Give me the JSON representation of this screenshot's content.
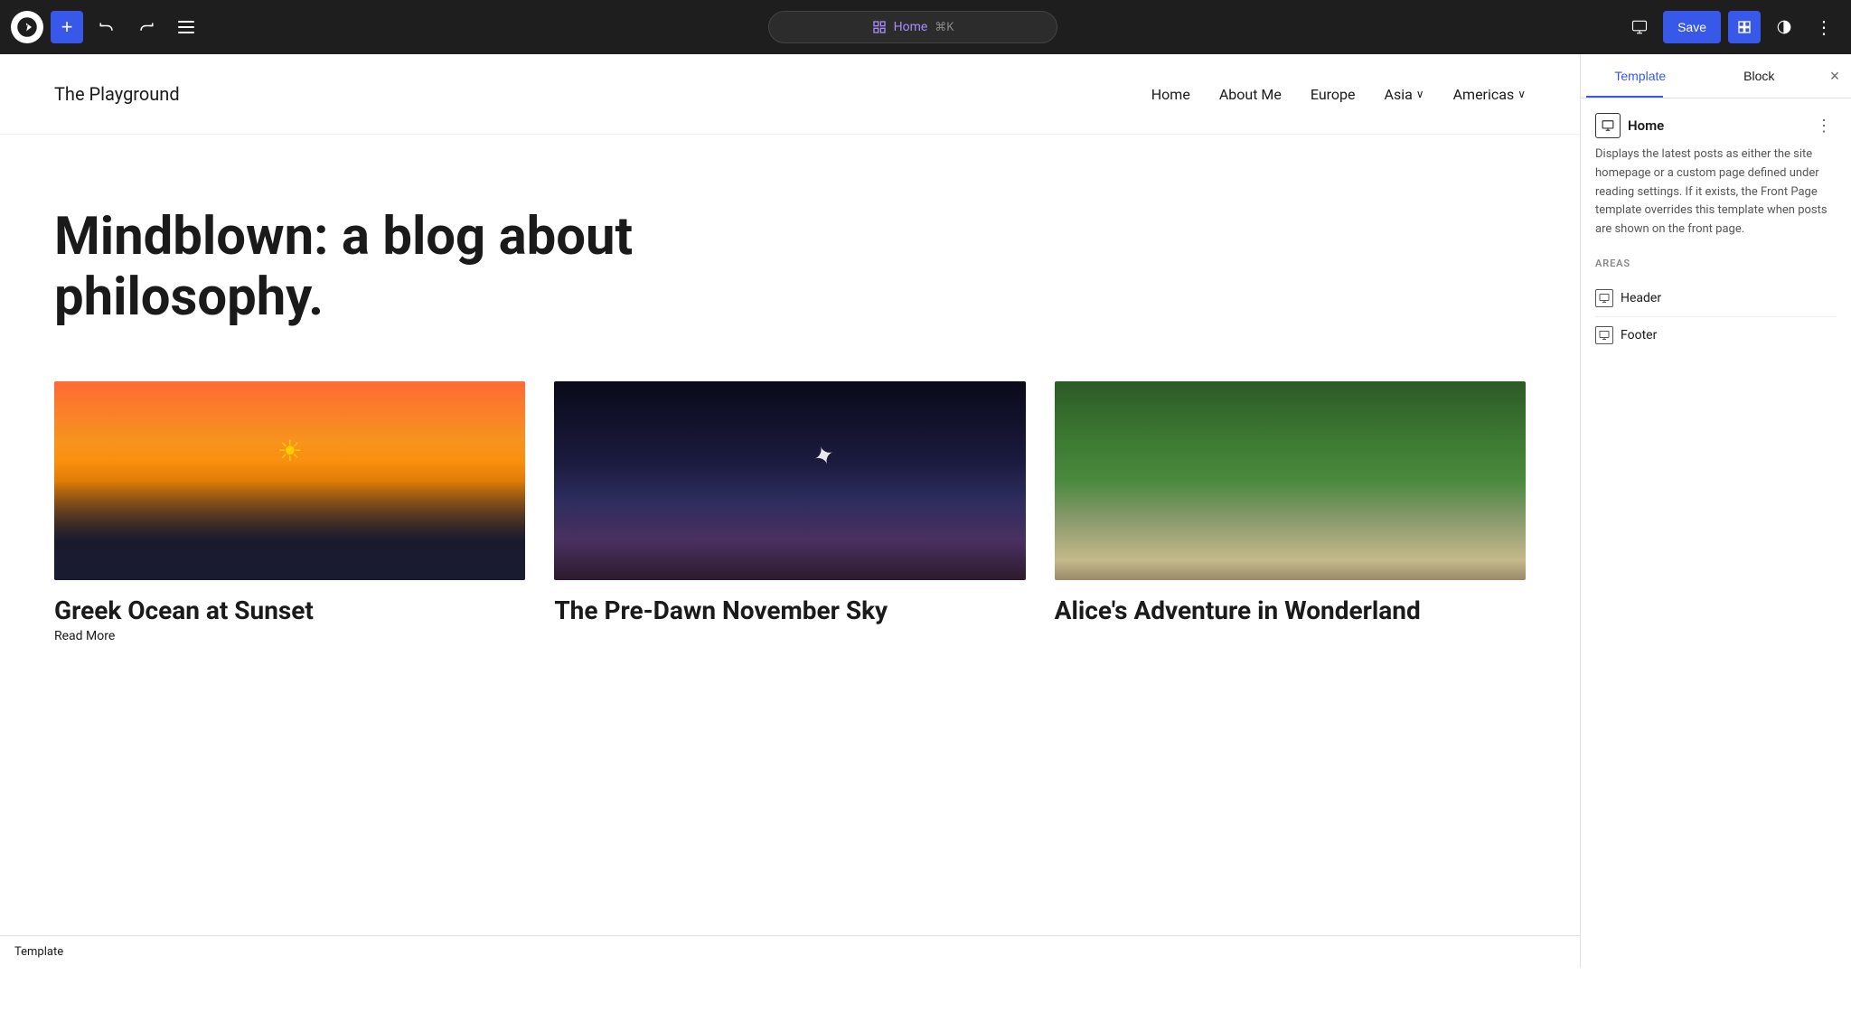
{
  "toolbar": {
    "add_button_label": "+",
    "undo_label": "←",
    "redo_label": "→",
    "url_icon": "□",
    "url_label": "Home",
    "url_shortcut": "⌘K",
    "save_label": "Save",
    "desktop_icon": "▭",
    "layout_icon": "▣",
    "contrast_icon": "◑",
    "more_options_icon": "⋮"
  },
  "site": {
    "title": "The Playground",
    "nav": [
      {
        "label": "Home",
        "has_dropdown": false
      },
      {
        "label": "About Me",
        "has_dropdown": false
      },
      {
        "label": "Europe",
        "has_dropdown": false
      },
      {
        "label": "Asia",
        "has_dropdown": true
      },
      {
        "label": "Americas",
        "has_dropdown": true
      }
    ]
  },
  "hero": {
    "title": "Mindblown: a blog about philosophy."
  },
  "posts": [
    {
      "title": "Greek Ocean at Sunset",
      "read_more": "Read More",
      "image_type": "sunset"
    },
    {
      "title": "The Pre-Dawn November Sky",
      "read_more": "",
      "image_type": "sky"
    },
    {
      "title": "Alice's Adventure in Wonderland",
      "read_more": "",
      "image_type": "wonderland"
    }
  ],
  "status_bar": {
    "label": "Template"
  },
  "right_panel": {
    "tab_template": "Template",
    "tab_block": "Block",
    "close_icon": "×",
    "template_icon": "▭",
    "template_name": "Home",
    "dots_icon": "⋮",
    "description": "Displays the latest posts as either the site homepage or a custom page defined under reading settings. If it exists, the Front Page template overrides this template when posts are shown on the front page.",
    "areas_label": "AREAS",
    "areas": [
      {
        "label": "Header",
        "icon": "▭"
      },
      {
        "label": "Footer",
        "icon": "▭"
      }
    ]
  }
}
